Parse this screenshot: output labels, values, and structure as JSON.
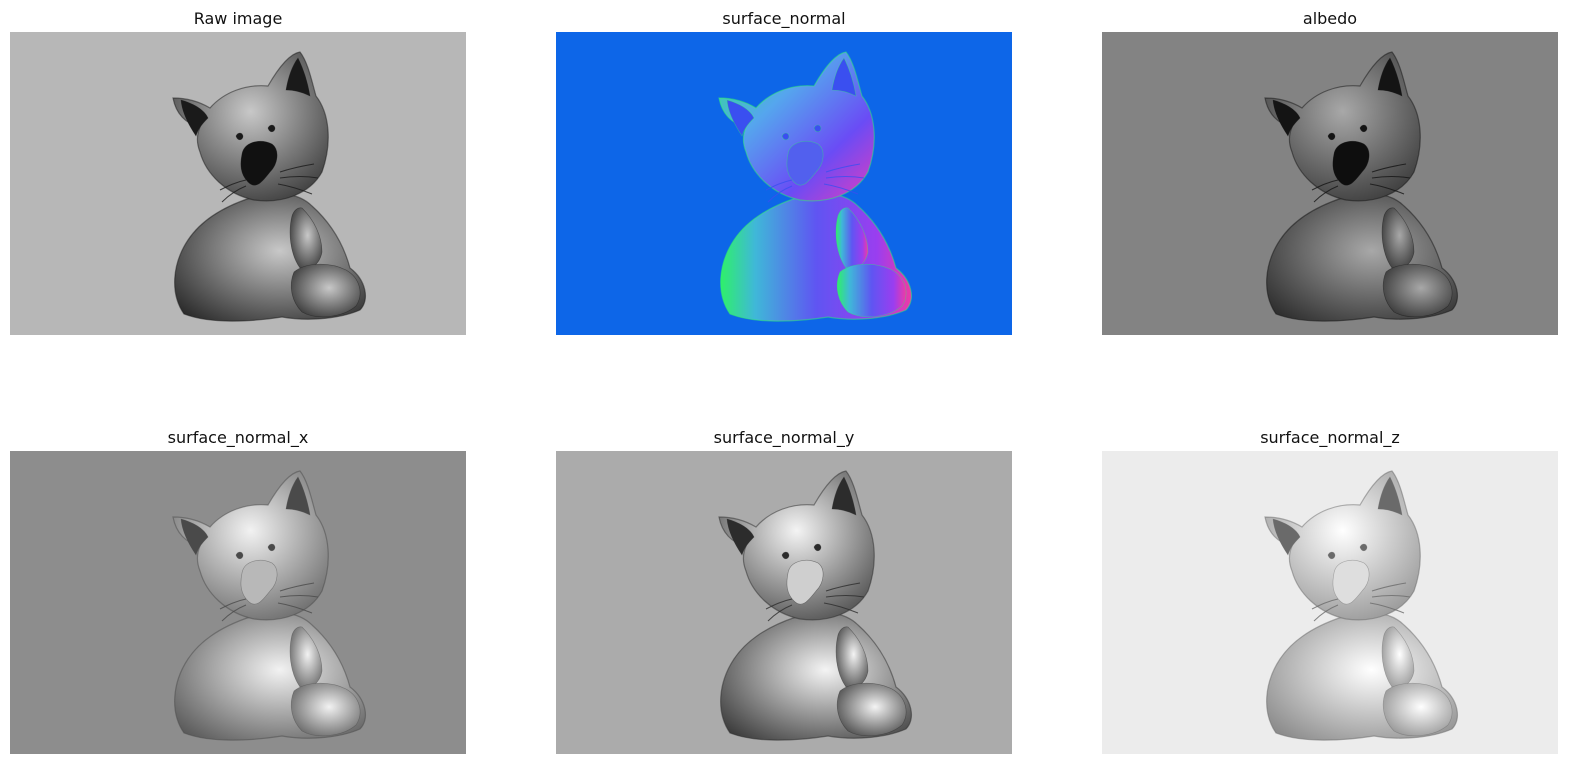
{
  "figure": {
    "panels": [
      {
        "title": "Raw image",
        "background": "#b7b7b7",
        "rendering": "raw"
      },
      {
        "title": "surface_normal",
        "background": "#0d66e8",
        "rendering": "normal-rgb"
      },
      {
        "title": "albedo",
        "background": "#838383",
        "rendering": "albedo"
      },
      {
        "title": "surface_normal_x",
        "background": "#8d8d8d",
        "rendering": "normal-x"
      },
      {
        "title": "surface_normal_y",
        "background": "#ababab",
        "rendering": "normal-y"
      },
      {
        "title": "surface_normal_z",
        "background": "#ececec",
        "rendering": "normal-z"
      }
    ]
  }
}
